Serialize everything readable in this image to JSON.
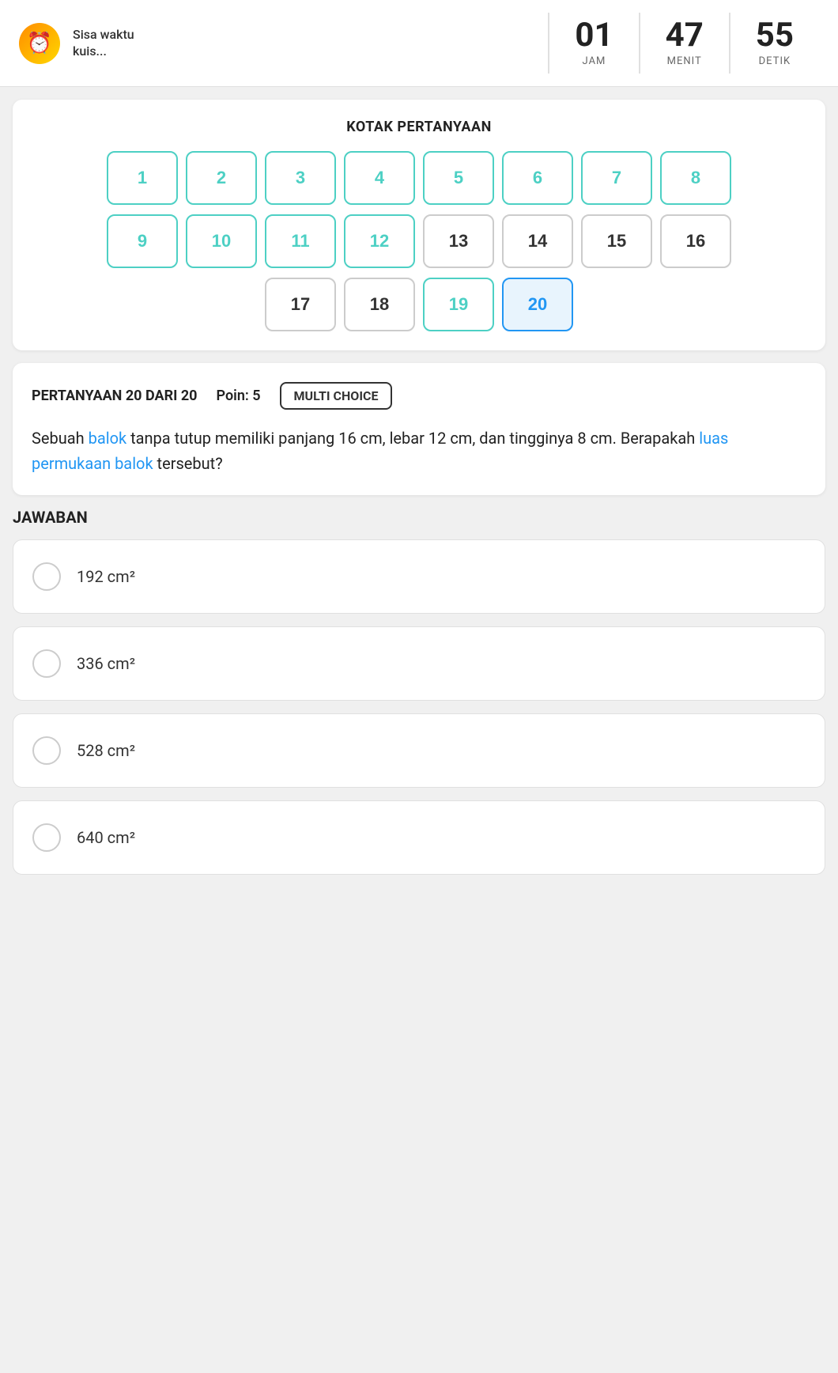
{
  "timer": {
    "icon": "⏰",
    "label": "Sisa waktu\nkuis...",
    "hours": "01",
    "minutes": "47",
    "seconds": "55",
    "jam_label": "JAM",
    "menit_label": "MENIT",
    "detik_label": "DETIK"
  },
  "question_box": {
    "title": "KOTAK PERTANYAAN",
    "numbers": [
      1,
      2,
      3,
      4,
      5,
      6,
      7,
      8,
      9,
      10,
      11,
      12,
      13,
      14,
      15,
      16,
      17,
      18,
      19,
      20
    ],
    "answered": [
      1,
      2,
      3,
      4,
      5,
      6,
      7,
      8,
      9,
      10,
      11,
      12
    ],
    "current": 20,
    "active_blue": 19
  },
  "question": {
    "header_label": "PERTANYAAN 20 DARI 20",
    "points_label": "Poin: 5",
    "type_label": "MULTI CHOICE",
    "text_part1": "Sebuah ",
    "text_highlight1": "balok",
    "text_part2": " tanpa tutup memiliki panjang 16 cm, lebar 12 cm, dan tingginya 8 cm. Berapakah ",
    "text_highlight2": "luas permukaan balok",
    "text_part3": " tersebut?"
  },
  "answers": {
    "title": "JAWABAN",
    "options": [
      {
        "id": "a",
        "text": "192 cm²"
      },
      {
        "id": "b",
        "text": "336 cm²"
      },
      {
        "id": "c",
        "text": "528 cm²"
      },
      {
        "id": "d",
        "text": "640 cm²"
      }
    ]
  }
}
